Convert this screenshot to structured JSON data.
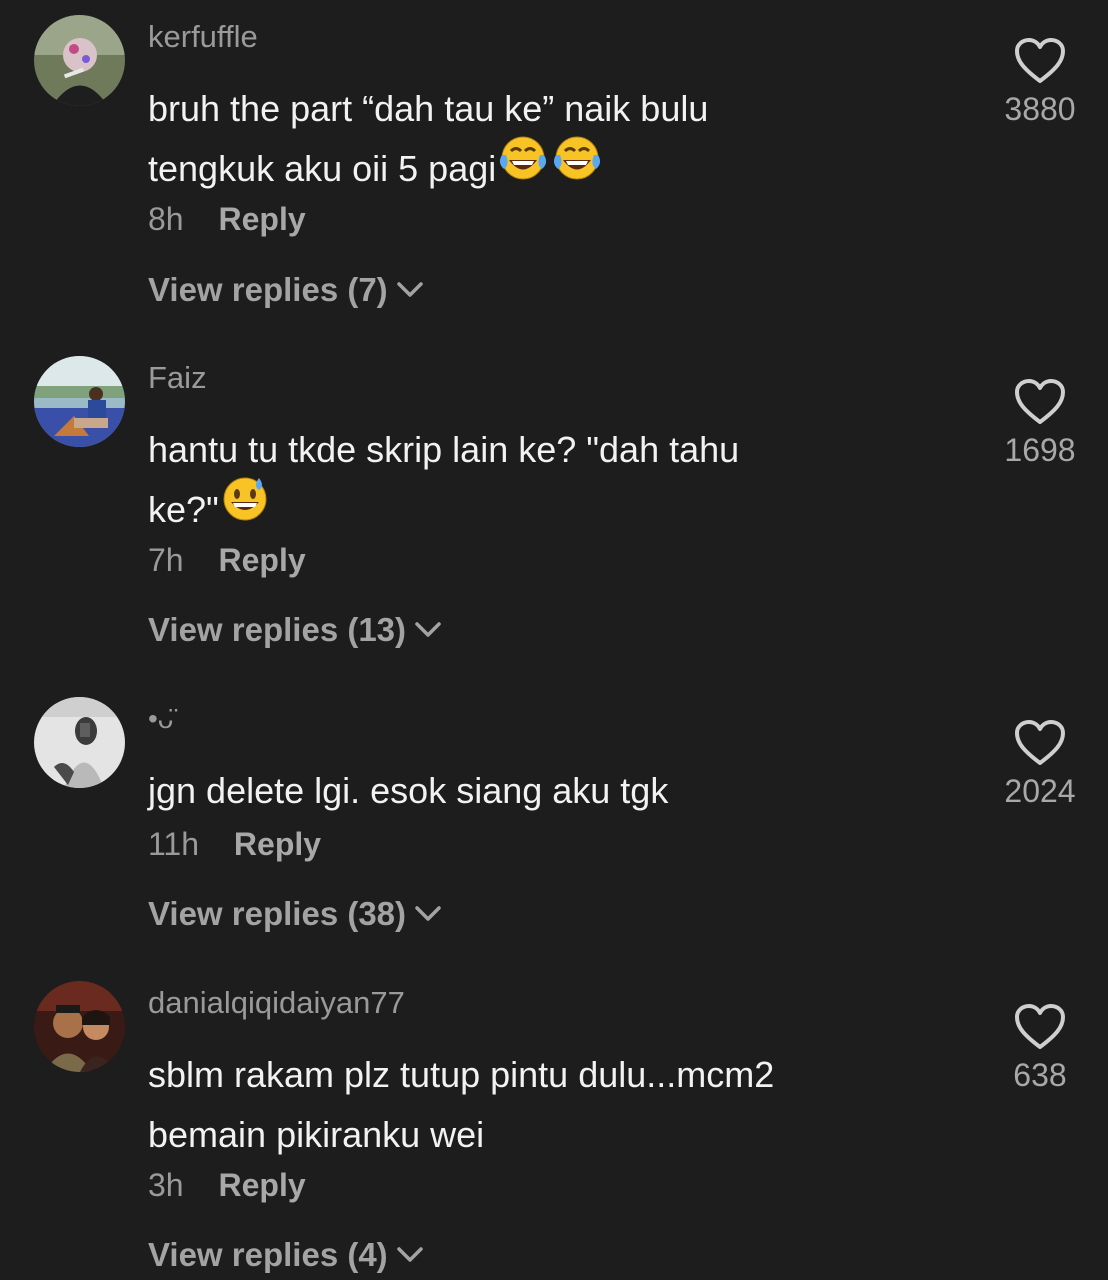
{
  "comments": [
    {
      "username": "kerfuffle",
      "text_line1": "bruh the part “dah tau ke” naik bulu",
      "text_line2": "tengkuk aku oii 5 pagi",
      "emoji": [
        "face-with-tears-of-joy-icon",
        "face-with-tears-of-joy-icon"
      ],
      "time": "8h",
      "reply_label": "Reply",
      "view_replies": "View replies (7)",
      "likes": "3880"
    },
    {
      "username": "Faiz",
      "text_line1": "hantu tu tkde skrip lain ke? \"dah tahu",
      "text_line2": "ke?\"",
      "emoji": [
        "grinning-face-with-sweat-icon"
      ],
      "time": "7h",
      "reply_label": "Reply",
      "view_replies": "View replies (13)",
      "likes": "1698"
    },
    {
      "username": "•ᴗ̈",
      "text_line1": "jgn delete lgi. esok siang aku tgk",
      "time": "11h",
      "reply_label": "Reply",
      "view_replies": "View replies (38)",
      "likes": "2024"
    },
    {
      "username": "danialqiqidaiyan77",
      "text_line1": "sblm rakam plz tutup pintu dulu...mcm2",
      "text_line2": "bemain pikiranku wei",
      "time": "3h",
      "reply_label": "Reply",
      "view_replies": "View replies (4)",
      "likes": "638"
    }
  ],
  "colors": {
    "background": "#1d1d1d",
    "primary_text": "#f2f2f2",
    "secondary_text": "#9a9a9a"
  }
}
